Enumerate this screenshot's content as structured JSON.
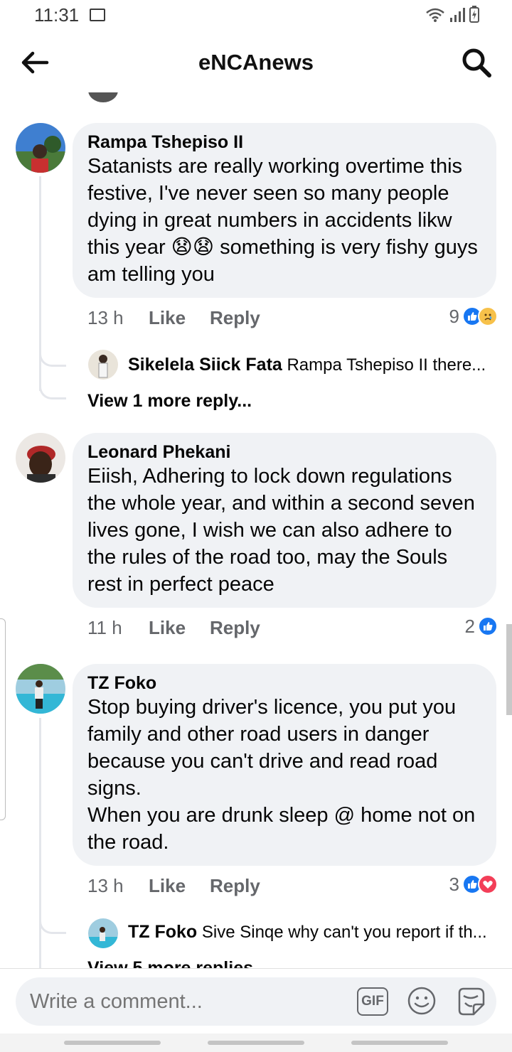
{
  "status": {
    "time": "11:31"
  },
  "header": {
    "title": "eNCAnews"
  },
  "comments": [
    {
      "author": "Rampa Tshepiso II",
      "text": "Satanists are really working overtime this festive,  I've never seen so many people dying in great numbers in accidents likw this year 😧😧 something is very fishy guys am telling you",
      "time": "13 h",
      "like_label": "Like",
      "reply_label": "Reply",
      "reaction_count": "9",
      "reactions": [
        "like-icon",
        "sad-icon"
      ],
      "reply_preview": {
        "author": "Sikelela Siick Fata",
        "text": "Rampa Tshepiso II there..."
      },
      "view_more": "View 1 more reply..."
    },
    {
      "author": "Leonard Phekani",
      "text": "Eiish, Adhering to lock down regulations the whole year, and within a second seven lives gone, I wish we can also adhere to the rules of the road too, may the Souls rest in perfect peace",
      "time": "11 h",
      "like_label": "Like",
      "reply_label": "Reply",
      "reaction_count": "2",
      "reactions": [
        "like-icon"
      ]
    },
    {
      "author": "TZ Foko",
      "text": "Stop buying driver's licence, you put you family and other road users in danger because you can't drive and read road signs.\nWhen you are drunk sleep @ home not on the road.",
      "time": "13 h",
      "like_label": "Like",
      "reply_label": "Reply",
      "reaction_count": "3",
      "reactions": [
        "like-icon",
        "love-icon"
      ],
      "reply_preview": {
        "author": "TZ Foko",
        "text": "Sive Sinqe why can't you report if th..."
      },
      "view_more": "View 5 more replies"
    }
  ],
  "composer": {
    "placeholder": "Write a comment...",
    "gif_label": "GIF"
  },
  "colors": {
    "accent": "#1877f2",
    "bubble": "#f0f2f5",
    "muted": "#65676b",
    "love": "#f33e58",
    "sad": "#f7c14a"
  }
}
